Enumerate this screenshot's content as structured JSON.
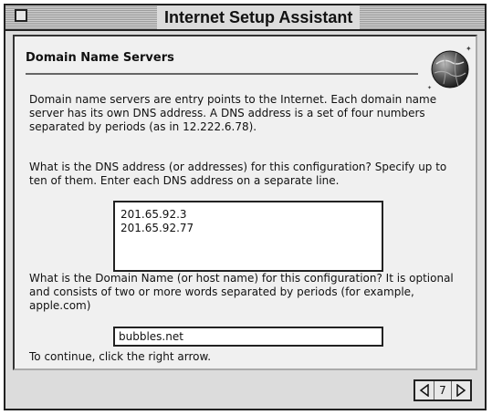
{
  "window": {
    "title": "Internet Setup Assistant"
  },
  "panel": {
    "heading": "Domain Name Servers",
    "intro": "Domain name servers are entry points to the Internet.  Each domain name server has its own DNS address.  A DNS address is a set of four numbers separated by periods (as in 12.222.6.78).",
    "dns_question": "What is the DNS address (or addresses) for this configuration?  Specify up to ten of them.  Enter each DNS address on a separate line.",
    "dns_addresses": [
      "201.65.92.3",
      "201.65.92.77"
    ],
    "domain_question": "What is the Domain Name (or host name) for this configuration?  It is optional and consists of two or more words separated by periods (for example, apple.com)",
    "domain_value": "bubbles.net",
    "continue_hint": "To continue, click the right arrow."
  },
  "nav": {
    "page_number": "7",
    "prev_icon": "left-arrow-icon",
    "next_icon": "right-arrow-icon"
  },
  "icons": {
    "globe": "globe-icon",
    "close": "close-box-icon"
  }
}
